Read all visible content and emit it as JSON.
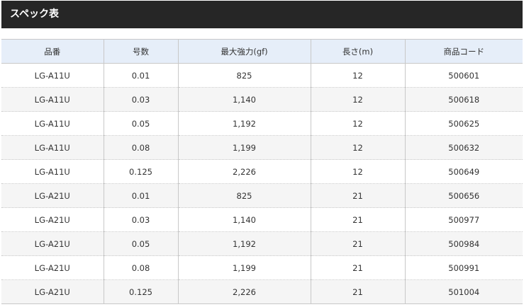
{
  "section": {
    "title": "スペック表"
  },
  "table": {
    "columns": [
      "品番",
      "号数",
      "最大強力(gf)",
      "長さ(m)",
      "商品コード"
    ],
    "rows": [
      [
        "LG-A11U",
        "0.01",
        "825",
        "12",
        "500601"
      ],
      [
        "LG-A11U",
        "0.03",
        "1,140",
        "12",
        "500618"
      ],
      [
        "LG-A11U",
        "0.05",
        "1,192",
        "12",
        "500625"
      ],
      [
        "LG-A11U",
        "0.08",
        "1,199",
        "12",
        "500632"
      ],
      [
        "LG-A11U",
        "0.125",
        "2,226",
        "12",
        "500649"
      ],
      [
        "LG-A21U",
        "0.01",
        "825",
        "21",
        "500656"
      ],
      [
        "LG-A21U",
        "0.03",
        "1,140",
        "21",
        "500977"
      ],
      [
        "LG-A21U",
        "0.05",
        "1,192",
        "21",
        "500984"
      ],
      [
        "LG-A21U",
        "0.08",
        "1,199",
        "21",
        "500991"
      ],
      [
        "LG-A21U",
        "0.125",
        "2,226",
        "21",
        "501004"
      ]
    ]
  },
  "colors": {
    "header_bar": "#262626",
    "table_header_bg": "#e6eef9",
    "row_alt_bg": "#f5f5f5",
    "border": "#c8c8c8",
    "text": "#333333"
  }
}
